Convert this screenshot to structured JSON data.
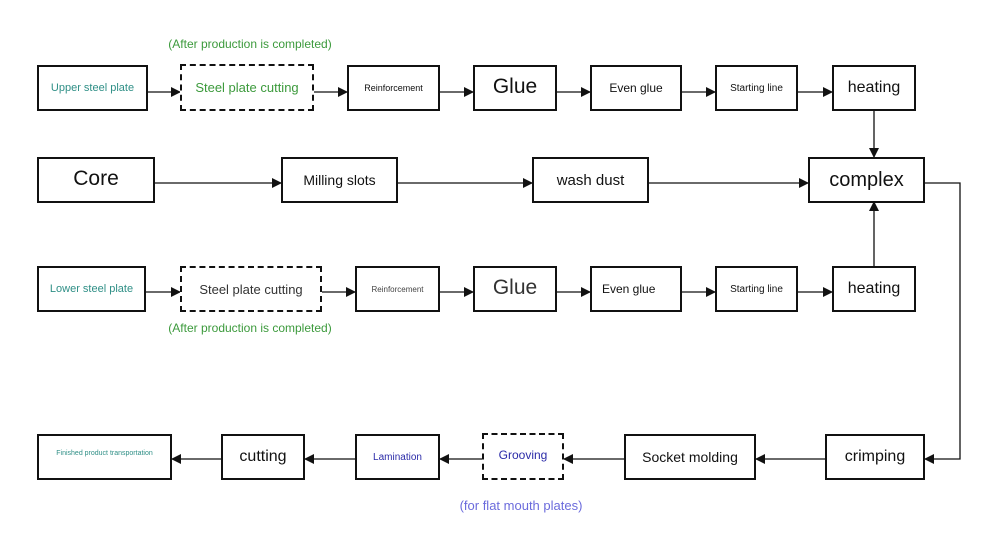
{
  "colors": {
    "teal": "#2f8f86",
    "green": "#3c9a3c",
    "blue": "#2b2ba8",
    "lightblue": "#6b6bdc",
    "line": "#111111"
  },
  "notes": {
    "top": "(After production is completed)",
    "middle": "(After production is completed)",
    "bottom": "(for flat mouth plates)"
  },
  "row1": {
    "upper_steel_plate": "Upper steel plate",
    "steel_plate_cutting": "Steel plate cutting",
    "reinforcement": "Reinforcement",
    "glue": "Glue",
    "even_glue": "Even glue",
    "starting_line": "Starting line",
    "heating": "heating"
  },
  "row2": {
    "core": "Core",
    "milling_slots": "Milling slots",
    "wash_dust": "wash dust",
    "complex": "complex"
  },
  "row3": {
    "lower_steel_plate": "Lower steel plate",
    "steel_plate_cutting": "Steel plate cutting",
    "reinforcement": "Reinforcement",
    "glue": "Glue",
    "even_glue": "Even glue",
    "starting_line": "Starting line",
    "heating": "heating"
  },
  "row4": {
    "finished": "Finished product transportation",
    "cutting": "cutting",
    "lamination": "Lamination",
    "grooving": "Grooving",
    "socket_molding": "Socket molding",
    "crimping": "crimping"
  }
}
